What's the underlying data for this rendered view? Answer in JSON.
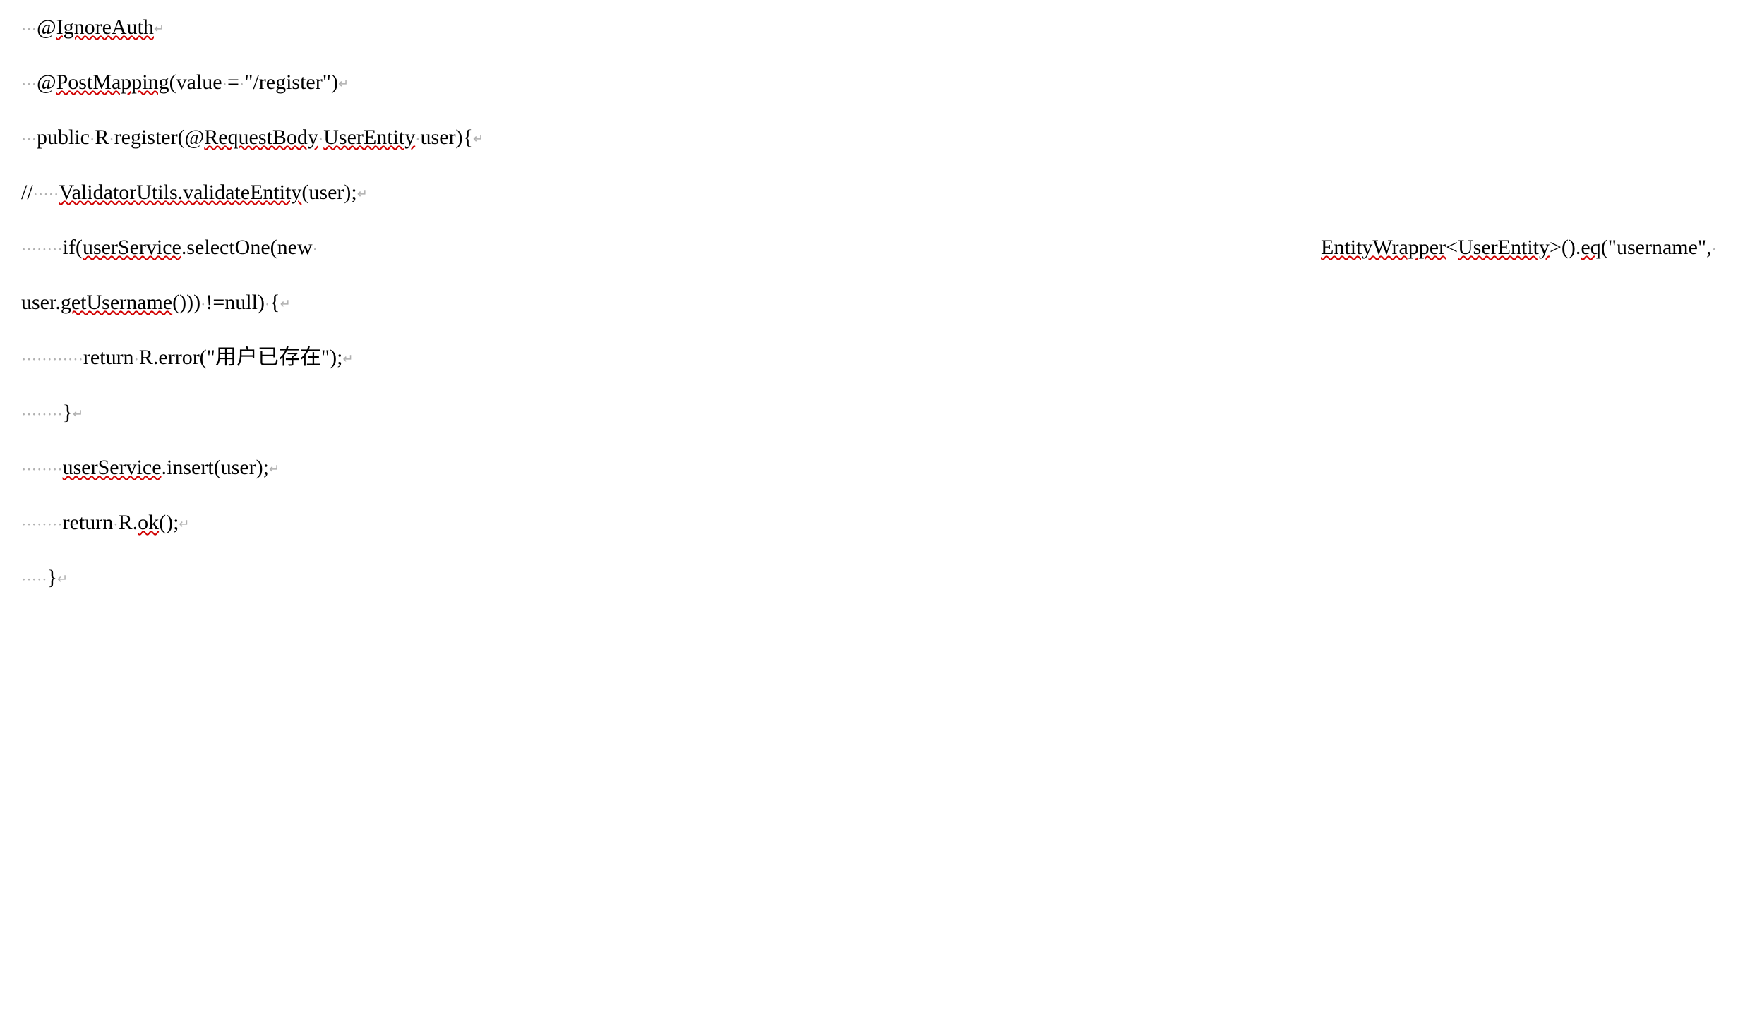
{
  "code": {
    "line1": {
      "text": "@IgnoreAuth",
      "indent_dots": "···"
    },
    "line2": {
      "prefix": "@",
      "squiggle": "PostMapping",
      "mid": "(value",
      "eq": "=",
      "rest": "\"/register\")",
      "indent_dots": "···"
    },
    "line3": {
      "t1": "public",
      "t2": "R",
      "t3": "register(@",
      "sq1": "RequestBody",
      "sq2": "UserEntity",
      "t4": "user){",
      "indent_dots": "···"
    },
    "line4": {
      "prefix": "//",
      "dots": "·····",
      "sq1": "ValidatorUtils.validateEntity",
      "t1": "(user);"
    },
    "line5a": {
      "dots": "········",
      "t1": "if(",
      "sq1": "userService",
      "t2": ".selectOne(new",
      "sq2": "EntityWrapper",
      "t3": "<",
      "sq3": "UserEntity",
      "t4": ">().",
      "sq4": "eq",
      "t5": "(\"username\","
    },
    "line5b": {
      "t1": "user.",
      "sq1": "getUsername",
      "t2": "()))",
      "t3": "!=null)",
      "t4": "{"
    },
    "line6": {
      "dots": "············",
      "t1": "return",
      "t2": "R.error(\"用户已存在\");"
    },
    "line7": {
      "dots": "········",
      "t1": "}"
    },
    "line8": {
      "dots": "········",
      "sq1": "userService",
      "t1": ".insert(user);"
    },
    "line9": {
      "dots": "········",
      "t1": "return",
      "t2": "R.",
      "sq1": "ok",
      "t3": "();"
    },
    "line10": {
      "dots": "·····",
      "t1": "}"
    }
  },
  "marks": {
    "return": "↵"
  }
}
